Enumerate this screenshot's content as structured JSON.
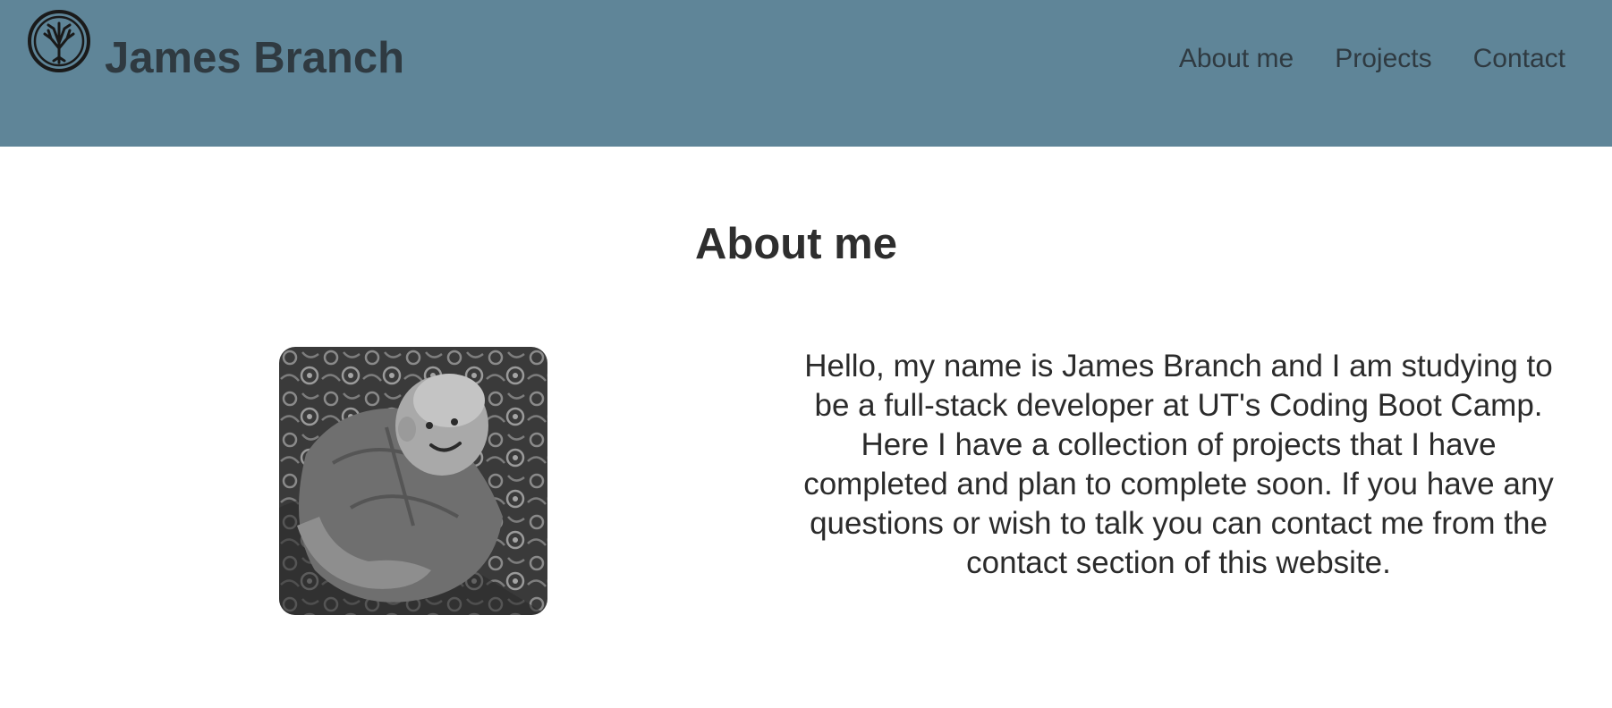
{
  "header": {
    "site_name": "James Branch",
    "logo_icon": "tree-circle-icon",
    "background_color": "#5f8598"
  },
  "nav": {
    "items": [
      {
        "label": "About me"
      },
      {
        "label": "Projects"
      },
      {
        "label": "Contact"
      }
    ]
  },
  "about": {
    "title": "About me",
    "photo_icon": "profile-photo",
    "bio": "Hello, my name is James Branch and I am studying to be a full-stack developer at UT's Coding Boot Camp. Here I have a collection of projects that I have completed and plan to complete soon. If you have any questions or wish to talk you can contact me from the contact section of this website."
  }
}
